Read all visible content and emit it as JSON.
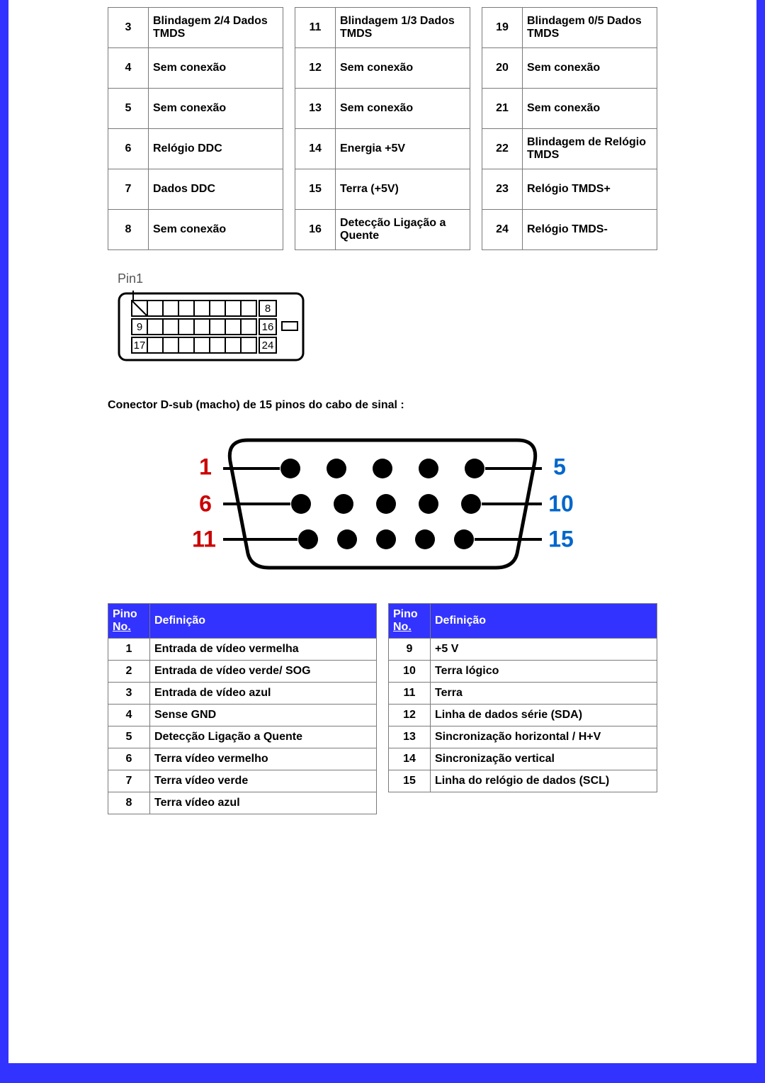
{
  "top_table": {
    "blocks": [
      [
        {
          "n": "3",
          "d": "Blindagem 2/4 Dados TMDS"
        },
        {
          "n": "4",
          "d": "Sem conexão"
        },
        {
          "n": "5",
          "d": "Sem conexão"
        },
        {
          "n": "6",
          "d": "Relógio DDC"
        },
        {
          "n": "7",
          "d": "Dados DDC"
        },
        {
          "n": "8",
          "d": "Sem conexão"
        }
      ],
      [
        {
          "n": "11",
          "d": "Blindagem 1/3 Dados TMDS"
        },
        {
          "n": "12",
          "d": "Sem conexão"
        },
        {
          "n": "13",
          "d": "Sem conexão"
        },
        {
          "n": "14",
          "d": "Energia +5V"
        },
        {
          "n": "15",
          "d": "Terra (+5V)"
        },
        {
          "n": "16",
          "d": "Detecção Ligação a Quente"
        }
      ],
      [
        {
          "n": "19",
          "d": "Blindagem 0/5 Dados TMDS"
        },
        {
          "n": "20",
          "d": "Sem conexão"
        },
        {
          "n": "21",
          "d": "Sem conexão"
        },
        {
          "n": "22",
          "d": "Blindagem de Relógio TMDS"
        },
        {
          "n": "23",
          "d": "Relógio TMDS+"
        },
        {
          "n": "24",
          "d": "Relógio TMDS-"
        }
      ]
    ]
  },
  "pin1_label": "Pin1",
  "dvi_diagram": {
    "right_labels": [
      "8",
      "16",
      "24"
    ],
    "left_labels": [
      "",
      "9",
      "17"
    ]
  },
  "caption": "Conector D-sub (macho) de 15 pinos do cabo de sinal :",
  "vga_diagram": {
    "left": [
      "1",
      "6",
      "11"
    ],
    "right": [
      "5",
      "10",
      "15"
    ]
  },
  "def_header": {
    "pino": "Pino",
    "no": "No.",
    "def": "Definição"
  },
  "defs_left": [
    {
      "n": "1",
      "d": "Entrada de vídeo vermelha"
    },
    {
      "n": "2",
      "d": "Entrada de vídeo verde/ SOG"
    },
    {
      "n": "3",
      "d": "Entrada de vídeo azul"
    },
    {
      "n": "4",
      "d": "Sense GND"
    },
    {
      "n": "5",
      "d": "Detecção Ligação a Quente"
    },
    {
      "n": "6",
      "d": "Terra vídeo vermelho"
    },
    {
      "n": "7",
      "d": "Terra vídeo verde"
    },
    {
      "n": "8",
      "d": "Terra vídeo azul"
    }
  ],
  "defs_right": [
    {
      "n": "9",
      "d": "+5 V"
    },
    {
      "n": "10",
      "d": "Terra lógico"
    },
    {
      "n": "11",
      "d": "Terra"
    },
    {
      "n": "12",
      "d": "Linha de dados série (SDA)"
    },
    {
      "n": "13",
      "d": "Sincronização horizontal / H+V"
    },
    {
      "n": "14",
      "d": "Sincronização vertical"
    },
    {
      "n": "15",
      "d": "Linha do relógio de dados (SCL)"
    }
  ]
}
